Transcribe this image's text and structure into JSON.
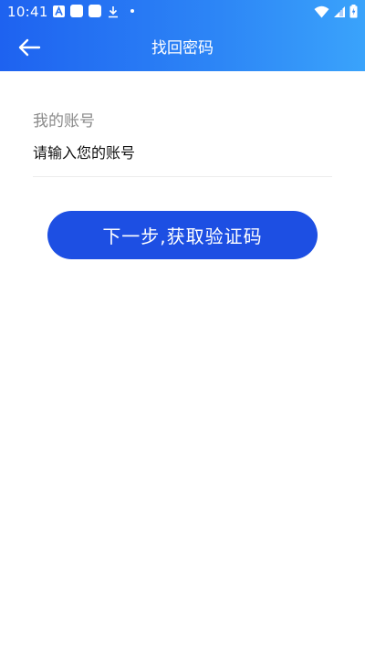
{
  "status_bar": {
    "time": "10:41",
    "icons_left": [
      "a-badge-icon",
      "app-square-icon",
      "app-square-icon",
      "download-icon",
      "dot-icon"
    ],
    "icons_right": [
      "wifi-icon",
      "cellular-signal-icon",
      "battery-charging-icon"
    ]
  },
  "app_bar": {
    "back_icon": "arrow-left-icon",
    "title": "找回密码"
  },
  "form": {
    "label": "我的账号",
    "account_input": {
      "value": "",
      "placeholder": "请输入您的账号"
    },
    "submit_label": "下一步,获取验证码"
  },
  "colors": {
    "header_gradient_start": "#1e62f0",
    "header_gradient_end": "#3aa3fb",
    "button": "#1d4fe3",
    "label_gray": "#8a8a8a"
  }
}
